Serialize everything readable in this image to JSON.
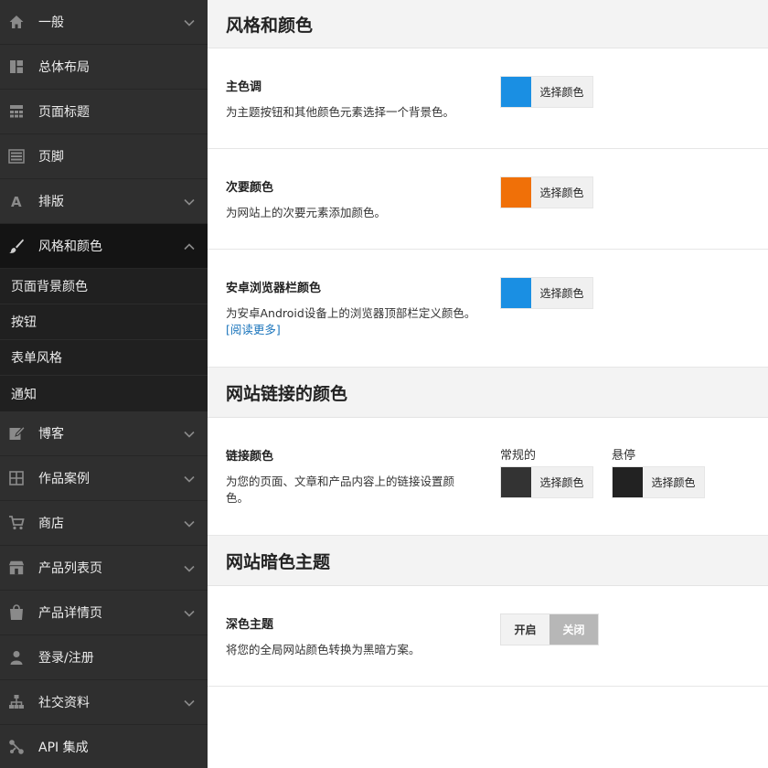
{
  "sidebar": {
    "items": [
      {
        "label": "一般",
        "icon": "home-icon",
        "chevron": "down"
      },
      {
        "label": "总体布局",
        "icon": "layout-icon",
        "chevron": ""
      },
      {
        "label": "页面标题",
        "icon": "page-title-icon",
        "chevron": ""
      },
      {
        "label": "页脚",
        "icon": "footer-icon",
        "chevron": ""
      },
      {
        "label": "排版",
        "icon": "typography-icon",
        "chevron": "down"
      },
      {
        "label": "风格和颜色",
        "icon": "brush-icon",
        "chevron": "up"
      }
    ],
    "sub_items": [
      {
        "label": "页面背景颜色"
      },
      {
        "label": "按钮"
      },
      {
        "label": "表单风格"
      },
      {
        "label": "通知"
      }
    ],
    "items_after": [
      {
        "label": "博客",
        "icon": "edit-icon",
        "chevron": "down"
      },
      {
        "label": "作品案例",
        "icon": "grid-icon",
        "chevron": "down"
      },
      {
        "label": "商店",
        "icon": "cart-icon",
        "chevron": "down"
      },
      {
        "label": "产品列表页",
        "icon": "store-icon",
        "chevron": "down"
      },
      {
        "label": "产品详情页",
        "icon": "product-icon",
        "chevron": "down"
      },
      {
        "label": "登录/注册",
        "icon": "user-icon",
        "chevron": ""
      },
      {
        "label": "社交资料",
        "icon": "network-icon",
        "chevron": "down"
      },
      {
        "label": "API 集成",
        "icon": "api-icon",
        "chevron": ""
      }
    ]
  },
  "sections": {
    "style": {
      "title": "风格和颜色",
      "primary": {
        "title": "主色调",
        "desc": "为主题按钮和其他颜色元素选择一个背景色。",
        "button": "选择颜色",
        "color": "#1a8fe3"
      },
      "secondary": {
        "title": "次要颜色",
        "desc": "为网站上的次要元素添加颜色。",
        "button": "选择颜色",
        "color": "#f07008"
      },
      "android": {
        "title": "安卓浏览器栏颜色",
        "desc": "为安卓Android设备上的浏览器顶部栏定义颜色。",
        "link": "[阅读更多]",
        "button": "选择颜色",
        "color": "#1a8fe3"
      }
    },
    "links": {
      "title": "网站链接的颜色",
      "link_color": {
        "title": "链接颜色",
        "desc": "为您的页面、文章和产品内容上的链接设置颜色。",
        "normal_label": "常规的",
        "hover_label": "悬停",
        "button": "选择颜色",
        "normal_color": "#333333",
        "hover_color": "#222222"
      }
    },
    "dark": {
      "title": "网站暗色主题",
      "dark_theme": {
        "title": "深色主题",
        "desc": "将您的全局网站颜色转换为黑暗方案。",
        "on": "开启",
        "off": "关闭"
      }
    }
  }
}
